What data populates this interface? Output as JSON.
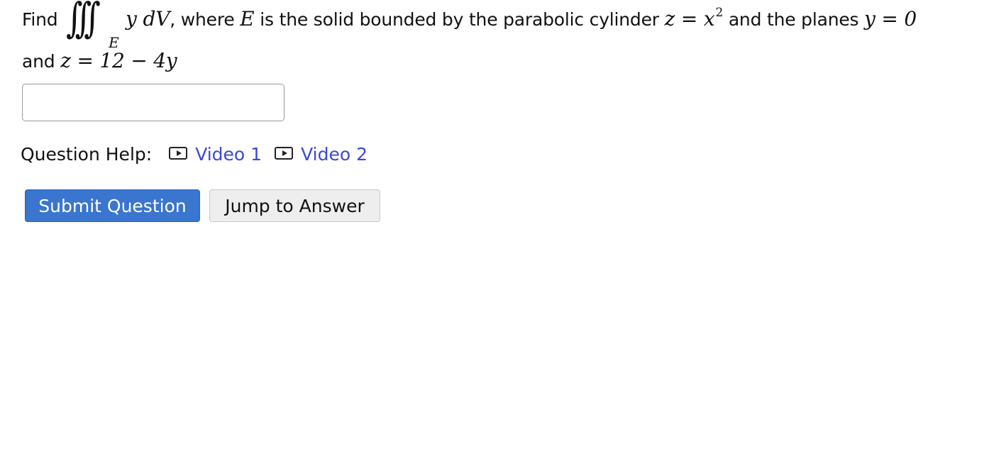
{
  "question": {
    "find": "Find",
    "integral_symbol": "∫∫∫",
    "integral_subscript": "E",
    "integrand": "y dV",
    "comma": ",",
    "where": "where",
    "region": "E",
    "description": "is the solid bounded by the parabolic cylinder",
    "cylinder_eq": "z = x",
    "exponent": "2",
    "and_planes": "and the planes",
    "plane1": "y = 0",
    "and": "and",
    "plane2": "z = 12 − 4y"
  },
  "answer_input": {
    "value": "",
    "placeholder": ""
  },
  "help": {
    "label": "Question Help:",
    "links": [
      {
        "label": "Video 1",
        "icon": "video-play-icon"
      },
      {
        "label": "Video 2",
        "icon": "video-play-icon"
      }
    ]
  },
  "buttons": {
    "submit": "Submit Question",
    "jump": "Jump to Answer"
  },
  "colors": {
    "link": "#3b49d6",
    "submit_bg": "#3a75cf",
    "jump_bg": "#eeeeee"
  }
}
